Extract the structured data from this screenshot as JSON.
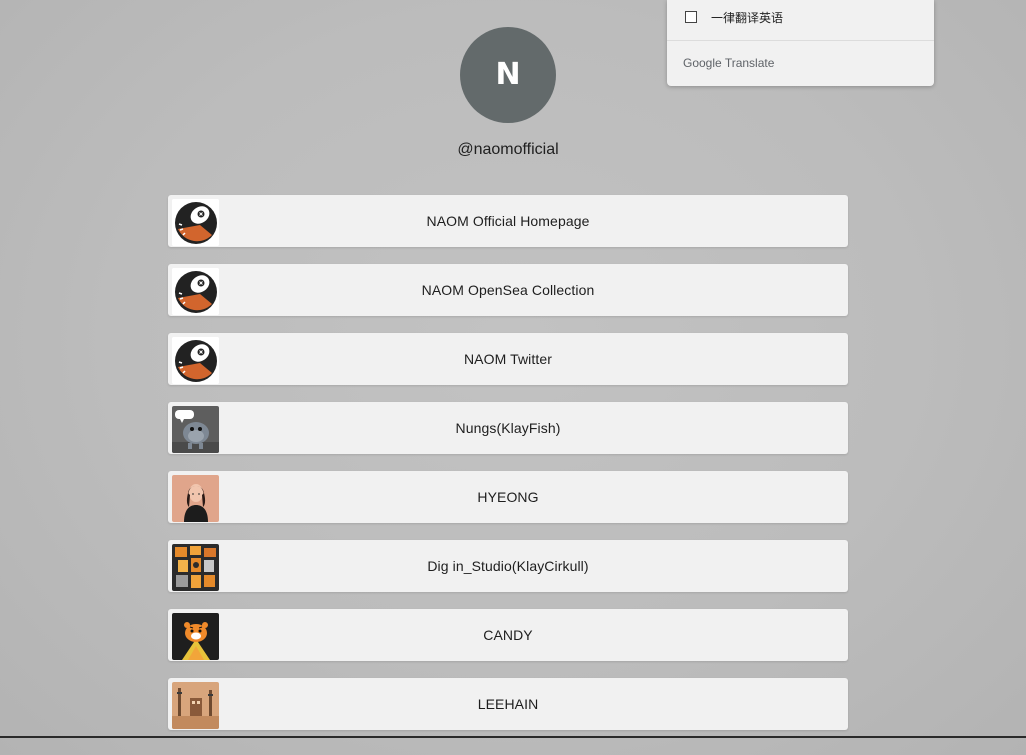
{
  "profile": {
    "avatar_letter": "N",
    "avatar_color": "#636a6b",
    "username": "@naomofficial"
  },
  "links": [
    {
      "label": "NAOM Official Homepage",
      "thumb": "naom-logo-icon"
    },
    {
      "label": "NAOM OpenSea Collection",
      "thumb": "naom-logo-icon"
    },
    {
      "label": "NAOM Twitter",
      "thumb": "naom-logo-icon"
    },
    {
      "label": "Nungs(KlayFish)",
      "thumb": "klayfish-fish-icon"
    },
    {
      "label": "HYEONG",
      "thumb": "hyeong-portrait-icon"
    },
    {
      "label": "Dig in_Studio(KlayCirkull)",
      "thumb": "klaycirkull-art-icon"
    },
    {
      "label": "CANDY",
      "thumb": "candy-tiger-icon"
    },
    {
      "label": "LEEHAIN",
      "thumb": "leehain-art-icon"
    }
  ],
  "translate_popup": {
    "checkbox_label": "一律翻译英语",
    "brand_google": "Google",
    "brand_translate": "Translate"
  },
  "colors": {
    "background": "#bdbdbd",
    "card": "#f1f1f1",
    "naom_orange": "#d2652d"
  }
}
